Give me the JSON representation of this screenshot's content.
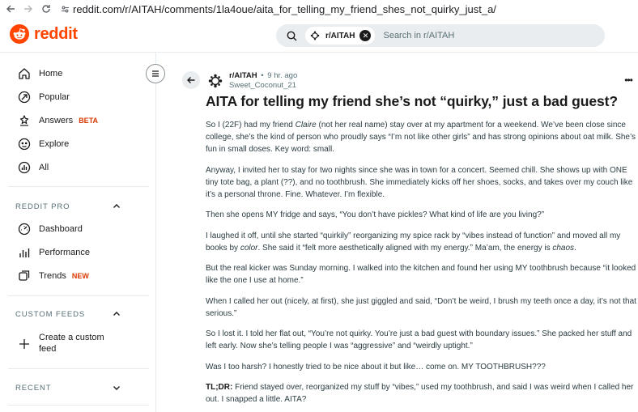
{
  "browser": {
    "url": "reddit.com/r/AITAH/comments/1la4oue/aita_for_telling_my_friend_shes_not_quirky_just_a/"
  },
  "header": {
    "logo_text": "reddit",
    "search": {
      "chip_label": "r/AITAH",
      "placeholder": "Search in r/AITAH"
    }
  },
  "sidebar": {
    "nav": [
      {
        "label": "Home",
        "icon": "home-icon"
      },
      {
        "label": "Popular",
        "icon": "popular-icon"
      },
      {
        "label": "Answers",
        "badge": "BETA",
        "icon": "answers-icon"
      },
      {
        "label": "Explore",
        "icon": "explore-icon"
      },
      {
        "label": "All",
        "icon": "all-icon"
      }
    ],
    "reddit_pro": {
      "title": "REDDIT PRO",
      "items": [
        {
          "label": "Dashboard",
          "icon": "dashboard-icon"
        },
        {
          "label": "Performance",
          "icon": "performance-icon"
        },
        {
          "label": "Trends",
          "badge": "NEW",
          "icon": "trends-icon"
        }
      ]
    },
    "custom_feeds": {
      "title": "CUSTOM FEEDS",
      "create_label_line1": "Create a custom",
      "create_label_line2": "feed"
    },
    "recent": {
      "title": "RECENT"
    }
  },
  "post": {
    "subreddit": "r/AITAH",
    "separator": "•",
    "time_ago": "9 hr. ago",
    "author": "Sweet_Coconut_21",
    "title": "AITA for telling my friend she’s not “quirky,” just a bad guest?",
    "paragraphs": {
      "p1a": "So I (22F) had my friend ",
      "p1b": "Claire",
      "p1c": " (not her real name) stay over at my apartment for a weekend. We’ve been close since college, she’s the kind of person who proudly says “I’m not like other girls” and has strong opinions about oat milk. She’s fun in small doses. Key word: small.",
      "p2": "Anyway, I invited her to stay for two nights since she was in town for a concert. Seemed chill. She shows up with ONE tiny tote bag, a plant (??), and no toothbrush. She immediately kicks off her shoes, socks, and takes over my couch like it’s a personal throne. Fine. Whatever. I’m flexible.",
      "p3": "Then she opens MY fridge and says, “You don’t have pickles? What kind of life are you living?”",
      "p4a": "I laughed it off, until she started “quirkily” reorganizing my spice rack by “vibes instead of function” and moved all my books by ",
      "p4b": "color",
      "p4c": ". She said it “felt more aesthetically aligned with my energy.” Ma’am, the energy is ",
      "p4d": "chaos",
      "p4e": ".",
      "p5": "But the real kicker was Sunday morning. I walked into the kitchen and found her using MY toothbrush because “it looked like the one I use at home.”",
      "p6": "When I called her out (nicely, at first), she just giggled and said, “Don’t be weird, I brush my teeth once a day, it’s not that serious.”",
      "p7": "So I lost it. I told her flat out, “You’re not quirky. You’re just a bad guest with boundary issues.” She packed her stuff and left early. Now she’s telling people I was “aggressive” and “weirdly uptight.”",
      "p8": "Was I too harsh? I honestly tried to be nice about it but like… come on. MY TOOTHBRUSH???",
      "p9_label": "TL;DR:",
      "p9": " Friend stayed over, reorganized my stuff by “vibes,” used my toothbrush, and said I was weird when I called her out. I snapped a little. AITA?"
    }
  },
  "colors": {
    "brand": "#ff4500",
    "badge": "#d93a00",
    "search_bg": "#eaedef",
    "muted": "#576f76"
  }
}
